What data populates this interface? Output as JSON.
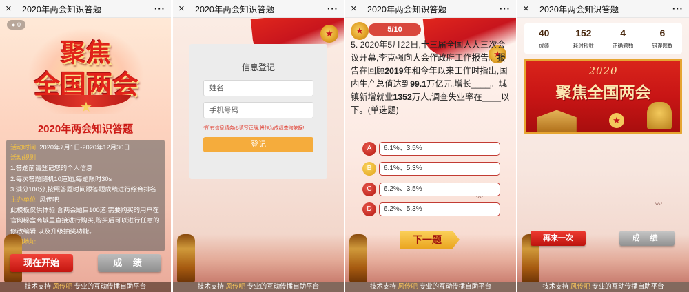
{
  "window": {
    "title": "2020年两会知识答题",
    "close_icon": "×",
    "more_icon": "···"
  },
  "footer": {
    "prefix": "技术支持",
    "brand": "风传吧",
    "suffix": "专业的互动传播自助平台"
  },
  "home": {
    "visit_count": "0",
    "logo_line1": "聚焦",
    "logo_line2": "全国两会",
    "title": "2020年两会知识答题",
    "info": {
      "time_label": "活动时间:",
      "time_value": "2020年7月1日-2020年12月30日",
      "rules_label": "活动规则:",
      "rule1": "1.答题前请登记您的个人信息",
      "rule2": "2.每次答题随机10道题,每题限时30s",
      "rule3": "3.满分100分,按照答题时间跟答题成绩进行综合排名",
      "host_label": "主办单位:",
      "host_value": "风传吧",
      "desc": "此模板仅供体验,含两会题目100道,需要购买的用户在官网秘盒商城里直接进行购买,购买后可以进行任意的修改编辑,以及升级抽奖功能。",
      "site_label": "官网地址:",
      "site_value": ""
    },
    "start_button": "现在开始",
    "score_button": "成 绩"
  },
  "register": {
    "title": "信息登记",
    "name_placeholder": "姓名",
    "phone_placeholder": "手机号码",
    "note": "*所有信息请务必填写正确,将作为成绩查询依据!",
    "submit": "登记"
  },
  "question": {
    "progress": "5/10",
    "text_1": "5. 2020年5月22日,十三届全国人大三次会议开幕,李克强向大会作政府工作报告。报告在回顾",
    "text_b1": "2019",
    "text_2": "年和今年以来工作时指出,国内生产总值达到",
    "text_b2": "99.1",
    "text_3": "万亿元,增长____。城镇新增就业",
    "text_b3": "1352",
    "text_4": "万人,调查失业率在____以下。(单选题)",
    "options": [
      {
        "letter": "A",
        "text": "6.1%、3.5%"
      },
      {
        "letter": "B",
        "text": "6.1%、5.3%"
      },
      {
        "letter": "C",
        "text": "6.2%、3.5%"
      },
      {
        "letter": "D",
        "text": "6.2%、5.3%"
      }
    ],
    "next_button": "下一题"
  },
  "result": {
    "stats": [
      {
        "value": "40",
        "label": "成绩"
      },
      {
        "value": "152",
        "label": "耗时秒数"
      },
      {
        "value": "4",
        "label": "正确题数"
      },
      {
        "value": "6",
        "label": "错误题数"
      }
    ],
    "banner_year": "2020",
    "banner_slogan": "聚焦全国两会",
    "retry_button": "再来一次",
    "score_button": "成 绩"
  },
  "colors": {
    "accent_red": "#c8151d",
    "gold": "#f5ac3c"
  }
}
